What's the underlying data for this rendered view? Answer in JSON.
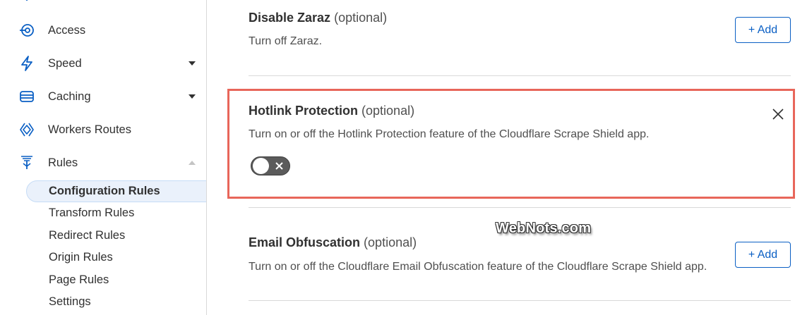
{
  "sidebar": {
    "items": [
      {
        "label": "Access",
        "icon": "access-icon"
      },
      {
        "label": "Speed",
        "icon": "lightning-icon"
      },
      {
        "label": "Caching",
        "icon": "caching-icon"
      },
      {
        "label": "Workers Routes",
        "icon": "workers-icon"
      },
      {
        "label": "Rules",
        "icon": "rules-icon"
      }
    ],
    "sub_items": [
      {
        "label": "Configuration Rules",
        "active": true
      },
      {
        "label": "Transform Rules"
      },
      {
        "label": "Redirect Rules"
      },
      {
        "label": "Origin Rules"
      },
      {
        "label": "Page Rules"
      },
      {
        "label": "Settings"
      }
    ]
  },
  "settings": [
    {
      "title": "Disable Zaraz",
      "optional": "(optional)",
      "description": "Turn off Zaraz.",
      "action": "+ Add"
    },
    {
      "title": "Hotlink Protection",
      "optional": "(optional)",
      "description": "Turn on or off the Hotlink Protection feature of the Cloudflare Scrape Shield app.",
      "toggle": "off"
    },
    {
      "title": "Email Obfuscation",
      "optional": "(optional)",
      "description": "Turn on or off the Cloudflare Email Obfuscation feature of the Cloudflare Scrape Shield app.",
      "action": "+ Add"
    }
  ],
  "watermark": "WebNots.com",
  "colors": {
    "accent": "#0a5fc4",
    "highlight": "#e8665a",
    "active_bg": "#eaf1fb"
  }
}
